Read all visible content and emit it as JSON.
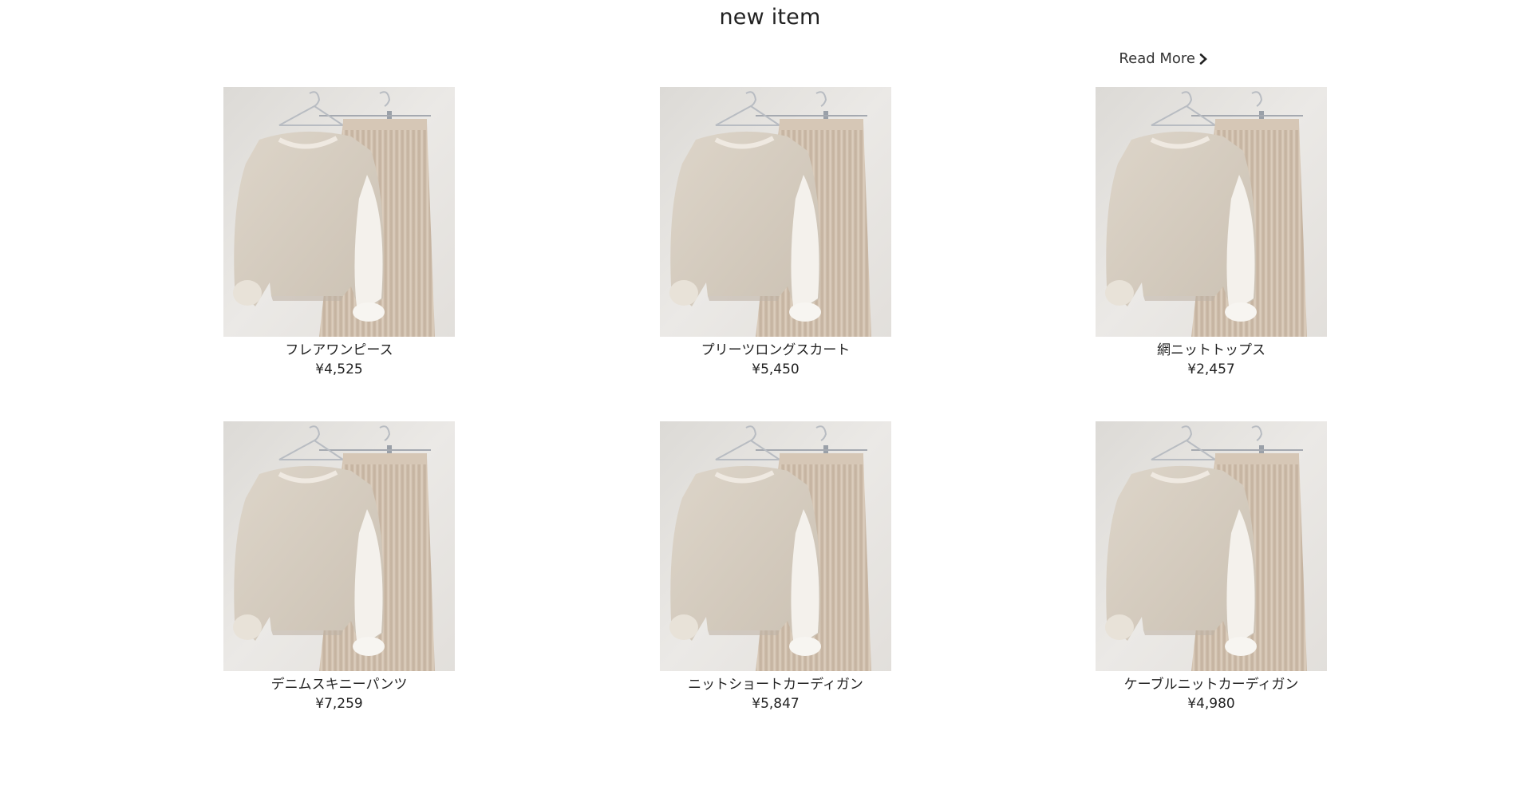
{
  "section": {
    "title": "new item",
    "read_more_label": "Read More",
    "read_more_icon": "chevron-right-icon"
  },
  "products": [
    {
      "name": "フレアワンピース",
      "price": "¥4,525"
    },
    {
      "name": "プリーツロングスカート",
      "price": "¥5,450"
    },
    {
      "name": "網ニットトップス",
      "price": "¥2,457"
    },
    {
      "name": "デニムスキニーパンツ",
      "price": "¥7,259"
    },
    {
      "name": "ニットショートカーディガン",
      "price": "¥5,847"
    },
    {
      "name": "ケーブルニットカーディガン",
      "price": "¥4,980"
    }
  ],
  "colors": {
    "background": "#ffffff",
    "text": "#222222",
    "wall": "#e6e4e0",
    "sweater": "#d9d0c3",
    "skirt": "#cfbfae"
  }
}
